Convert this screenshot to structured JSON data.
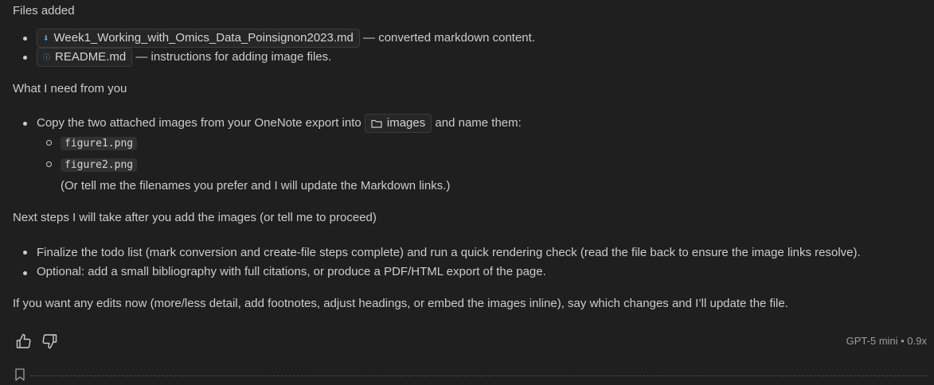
{
  "files_heading": "Files added",
  "files": [
    {
      "icon": "markdown-file-icon",
      "glyph": "⬇",
      "name": "Week1_Working_with_Omics_Data_Poinsignon2023.md",
      "desc": " — converted markdown content."
    },
    {
      "icon": "info-icon",
      "glyph": "ⓘ",
      "name": "README.md",
      "desc": " — instructions for adding image files."
    }
  ],
  "need_heading": "What I need from you",
  "need": {
    "text_before": "Copy the two attached images from your OneNote export into ",
    "folder_name": "images",
    "text_after": " and name them:",
    "sub_items": [
      "figure1.png",
      "figure2.png"
    ],
    "note": "(Or tell me the filenames you prefer and I will update the Markdown links.)"
  },
  "next_heading": "Next steps I will take after you add the images (or tell me to proceed)",
  "next_items": [
    "Finalize the todo list (mark conversion and create-file steps complete) and run a quick rendering check (read the file back to ensure the image links resolve).",
    "Optional: add a small bibliography with full citations, or produce a PDF/HTML export of the page."
  ],
  "closing": "If you want any edits now (more/less detail, add footnotes, adjust headings, or embed the images inline), say which changes and I’ll update the file.",
  "footer": {
    "model_info": "GPT-5 mini • 0.9x",
    "thumbs_up_icon": "thumbs-up-icon",
    "thumbs_down_icon": "thumbs-down-icon",
    "bookmark_icon": "bookmark-icon"
  },
  "colors": {
    "background": "#1f1f1f",
    "text": "#cccccc",
    "chip_border": "#3c3c3c",
    "code_bg": "#313131",
    "icon_accent": "#4ea1e8"
  }
}
